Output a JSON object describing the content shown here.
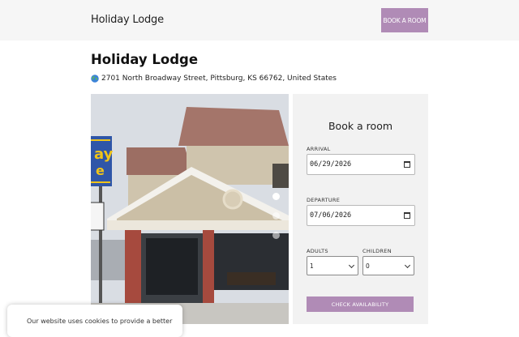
{
  "header": {
    "brand": "Holiday Lodge",
    "book_button": "BOOK A ROOM"
  },
  "property": {
    "name": "Holiday Lodge",
    "address": "2701 North Broadway Street, Pittsburg, KS 66762, United States"
  },
  "gallery": {
    "slide_count": 3,
    "active_index": 0
  },
  "booking": {
    "title": "Book a room",
    "arrival_label": "ARRIVAL",
    "arrival_value": "06/29/2026",
    "departure_label": "DEPARTURE",
    "departure_value": "07/06/2026",
    "adults_label": "ADULTS",
    "adults_value": "1",
    "children_label": "CHILDREN",
    "children_value": "0",
    "check_button": "CHECK AVAILABILITY"
  },
  "cookie": {
    "text": "Our website uses cookies to provide a better"
  },
  "colors": {
    "accent": "#b08bb6",
    "topbar": "#f6f6f6",
    "panel": "#f2f2f2"
  }
}
